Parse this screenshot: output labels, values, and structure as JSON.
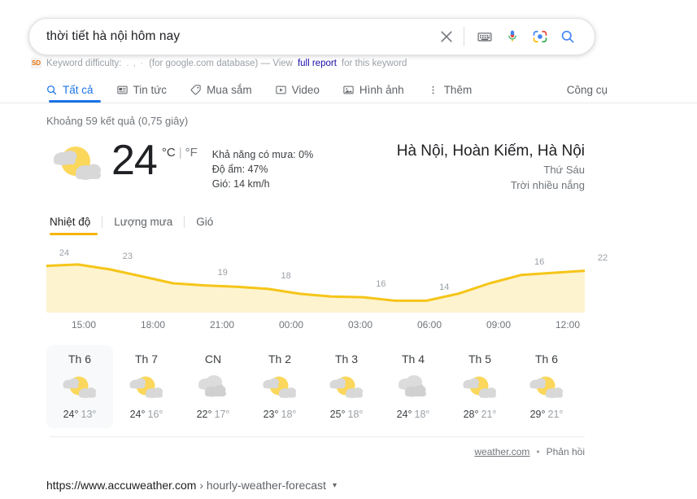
{
  "search": {
    "query": "thời tiết hà nội hôm nay",
    "icons": [
      "clear-icon",
      "keyboard-icon",
      "microphone-icon",
      "google-lens-icon",
      "search-icon"
    ]
  },
  "keyword_difficulty": {
    "label": "Keyword difficulty:",
    "dots": ". , ·",
    "database": "(for google.com database) — View",
    "link": "full report",
    "suffix": "for this keyword",
    "badge": "SD"
  },
  "tabs": [
    {
      "label": "Tất cả",
      "icon": "search-icon",
      "active": true
    },
    {
      "label": "Tin tức",
      "icon": "news-icon",
      "active": false
    },
    {
      "label": "Mua sắm",
      "icon": "shopping-tag-icon",
      "active": false
    },
    {
      "label": "Video",
      "icon": "video-icon",
      "active": false
    },
    {
      "label": "Hình ảnh",
      "icon": "image-icon",
      "active": false
    },
    {
      "label": "Thêm",
      "icon": "more-vertical-icon",
      "active": false
    }
  ],
  "tools_label": "Công cụ",
  "result_stats": "Khoảng 59 kết quả (0,75 giây)",
  "weather": {
    "icon": "partly-cloudy-icon",
    "temperature": "24",
    "unit_celsius": "°C",
    "unit_separator": "|",
    "unit_fahrenheit": "°F",
    "precipitation": "Khả năng có mưa: 0%",
    "humidity": "Độ ẩm: 47%",
    "wind": "Gió: 14 km/h",
    "location": "Hà Nội, Hoàn Kiếm, Hà Nội",
    "day": "Thứ Sáu",
    "condition": "Trời nhiều nắng",
    "chart_tabs": [
      {
        "label": "Nhiệt độ",
        "active": true
      },
      {
        "label": "Lượng mưa",
        "active": false
      },
      {
        "label": "Gió",
        "active": false
      }
    ],
    "footer": {
      "source": "weather.com",
      "separator": "•",
      "feedback": "Phản hồi"
    },
    "forecast": [
      {
        "name": "Th 6",
        "icon": "partly-cloudy-icon",
        "high": "24°",
        "low": "13°",
        "selected": true
      },
      {
        "name": "Th 7",
        "icon": "partly-cloudy-icon",
        "high": "24°",
        "low": "16°",
        "selected": false
      },
      {
        "name": "CN",
        "icon": "cloudy-icon",
        "high": "22°",
        "low": "17°",
        "selected": false
      },
      {
        "name": "Th 2",
        "icon": "partly-cloudy-icon",
        "high": "23°",
        "low": "18°",
        "selected": false
      },
      {
        "name": "Th 3",
        "icon": "partly-cloudy-icon",
        "high": "25°",
        "low": "18°",
        "selected": false
      },
      {
        "name": "Th 4",
        "icon": "cloudy-icon",
        "high": "24°",
        "low": "18°",
        "selected": false
      },
      {
        "name": "Th 5",
        "icon": "partly-cloudy-icon",
        "high": "28°",
        "low": "21°",
        "selected": false
      },
      {
        "name": "Th 6",
        "icon": "partly-cloudy-icon",
        "high": "29°",
        "low": "21°",
        "selected": false
      }
    ]
  },
  "chart_data": {
    "type": "area",
    "title": "Nhiệt độ",
    "xlabel": "",
    "ylabel": "°C",
    "grid": false,
    "legend": "none",
    "x": [
      "15:00",
      "18:00",
      "21:00",
      "00:00",
      "03:00",
      "06:00",
      "09:00",
      "12:00"
    ],
    "point_labels": [
      24,
      23,
      19,
      18,
      16,
      14,
      16,
      22
    ],
    "series": [
      {
        "name": "Nhiệt độ",
        "color": "#f5c518",
        "fill": "#fdf3cf",
        "values": [
          24,
          24.4,
          23,
          21,
          19,
          18.4,
          18,
          17.4,
          16,
          15.2,
          15,
          14,
          14,
          16,
          19,
          21.4,
          22,
          22.6
        ]
      }
    ],
    "ylim": [
      12,
      26
    ]
  },
  "organic_result": {
    "url": "https://www.accuweather.com",
    "chevron": "›",
    "path": "hourly-weather-forecast",
    "caret": "▾"
  }
}
